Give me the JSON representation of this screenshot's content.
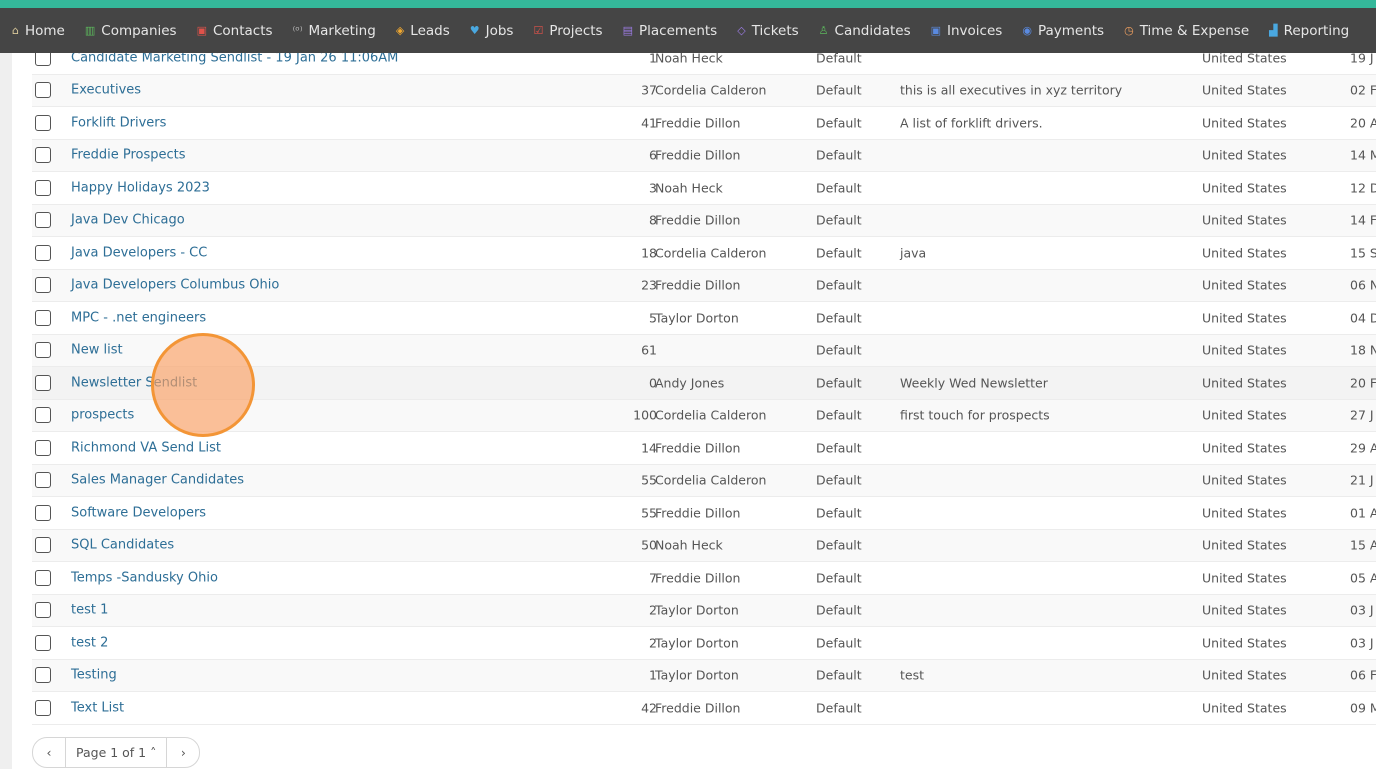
{
  "nav": {
    "items": [
      {
        "label": "Home",
        "icon": "home-icon",
        "glyph": "⌂",
        "color": "#d9c89a"
      },
      {
        "label": "Companies",
        "icon": "building-icon",
        "glyph": "▥",
        "color": "#5cb85c"
      },
      {
        "label": "Contacts",
        "icon": "contact-card-icon",
        "glyph": "▣",
        "color": "#e0524a"
      },
      {
        "label": "Marketing",
        "icon": "broadcast-icon",
        "glyph": "⁽ᵒ⁾",
        "color": "#bbbbbb"
      },
      {
        "label": "Leads",
        "icon": "target-icon",
        "glyph": "◈",
        "color": "#f0a830"
      },
      {
        "label": "Jobs",
        "icon": "trophy-icon",
        "glyph": "♥",
        "color": "#4aa8e0"
      },
      {
        "label": "Projects",
        "icon": "checkbox-icon",
        "glyph": "☑",
        "color": "#e0524a"
      },
      {
        "label": "Placements",
        "icon": "briefcase-icon",
        "glyph": "▤",
        "color": "#9a7ae0"
      },
      {
        "label": "Tickets",
        "icon": "ticket-icon",
        "glyph": "◇",
        "color": "#9a7ae0"
      },
      {
        "label": "Candidates",
        "icon": "users-icon",
        "glyph": "♙",
        "color": "#5cb85c"
      },
      {
        "label": "Invoices",
        "icon": "invoice-icon",
        "glyph": "▣",
        "color": "#5a8ae0"
      },
      {
        "label": "Payments",
        "icon": "coin-icon",
        "glyph": "◉",
        "color": "#5a8ae0"
      },
      {
        "label": "Time & Expense",
        "icon": "clock-icon",
        "glyph": "◷",
        "color": "#f0a060"
      },
      {
        "label": "Reporting",
        "icon": "bar-chart-icon",
        "glyph": "▟",
        "color": "#4aa8e0"
      }
    ]
  },
  "rows": [
    {
      "name": "Candidate Marketing Sendlist - 19 Jan 26 11:06AM",
      "count": "1",
      "owner": "Noah Heck",
      "type": "Default",
      "description": "",
      "country": "United States",
      "date": "19 J"
    },
    {
      "name": "Executives",
      "count": "37",
      "owner": "Cordelia Calderon",
      "type": "Default",
      "description": "this is all executives in xyz territory",
      "country": "United States",
      "date": "02 F"
    },
    {
      "name": "Forklift Drivers",
      "count": "41",
      "owner": "Freddie Dillon",
      "type": "Default",
      "description": "A list of forklift drivers.",
      "country": "United States",
      "date": "20 A"
    },
    {
      "name": "Freddie Prospects",
      "count": "6",
      "owner": "Freddie Dillon",
      "type": "Default",
      "description": "",
      "country": "United States",
      "date": "14 M"
    },
    {
      "name": "Happy Holidays 2023",
      "count": "3",
      "owner": "Noah Heck",
      "type": "Default",
      "description": "",
      "country": "United States",
      "date": "12 D"
    },
    {
      "name": "Java Dev Chicago",
      "count": "8",
      "owner": "Freddie Dillon",
      "type": "Default",
      "description": "",
      "country": "United States",
      "date": "14 F"
    },
    {
      "name": "Java Developers - CC",
      "count": "18",
      "owner": "Cordelia Calderon",
      "type": "Default",
      "description": "java",
      "country": "United States",
      "date": "15 S"
    },
    {
      "name": "Java Developers Columbus Ohio",
      "count": "23",
      "owner": "Freddie Dillon",
      "type": "Default",
      "description": "",
      "country": "United States",
      "date": "06 N"
    },
    {
      "name": "MPC - .net engineers",
      "count": "5",
      "owner": "Taylor Dorton",
      "type": "Default",
      "description": "",
      "country": "United States",
      "date": "04 D"
    },
    {
      "name": "New list",
      "count": "61",
      "owner": "",
      "type": "Default",
      "description": "",
      "country": "United States",
      "date": "18 N"
    },
    {
      "name": "Newsletter Sendlist",
      "count": "0",
      "owner": "Andy Jones",
      "type": "Default",
      "description": "Weekly Wed Newsletter",
      "country": "United States",
      "date": "20 F"
    },
    {
      "name": "prospects",
      "count": "100",
      "owner": "Cordelia Calderon",
      "type": "Default",
      "description": "first touch for prospects",
      "country": "United States",
      "date": "27 J"
    },
    {
      "name": "Richmond VA Send List",
      "count": "14",
      "owner": "Freddie Dillon",
      "type": "Default",
      "description": "",
      "country": "United States",
      "date": "29 A"
    },
    {
      "name": "Sales Manager Candidates",
      "count": "55",
      "owner": "Cordelia Calderon",
      "type": "Default",
      "description": "",
      "country": "United States",
      "date": "21 J"
    },
    {
      "name": "Software Developers",
      "count": "55",
      "owner": "Freddie Dillon",
      "type": "Default",
      "description": "",
      "country": "United States",
      "date": "01 A"
    },
    {
      "name": "SQL Candidates",
      "count": "50",
      "owner": "Noah Heck",
      "type": "Default",
      "description": "",
      "country": "United States",
      "date": "15 A"
    },
    {
      "name": "Temps -Sandusky Ohio",
      "count": "7",
      "owner": "Freddie Dillon",
      "type": "Default",
      "description": "",
      "country": "United States",
      "date": "05 A"
    },
    {
      "name": "test 1",
      "count": "2",
      "owner": "Taylor Dorton",
      "type": "Default",
      "description": "",
      "country": "United States",
      "date": "03 J"
    },
    {
      "name": "test 2",
      "count": "2",
      "owner": "Taylor Dorton",
      "type": "Default",
      "description": "",
      "country": "United States",
      "date": "03 J"
    },
    {
      "name": "Testing",
      "count": "1",
      "owner": "Taylor Dorton",
      "type": "Default",
      "description": "test",
      "country": "United States",
      "date": "06 F"
    },
    {
      "name": "Text List",
      "count": "42",
      "owner": "Freddie Dillon",
      "type": "Default",
      "description": "",
      "country": "United States",
      "date": "09 M"
    }
  ],
  "pagination": {
    "prev": "‹",
    "label": "Page 1 of 1 ˄",
    "next": "›"
  },
  "colors": {
    "accent": "#34b89a",
    "nav_bg": "#454545",
    "link": "#2d6e96",
    "click_indicator": "#f39536"
  }
}
